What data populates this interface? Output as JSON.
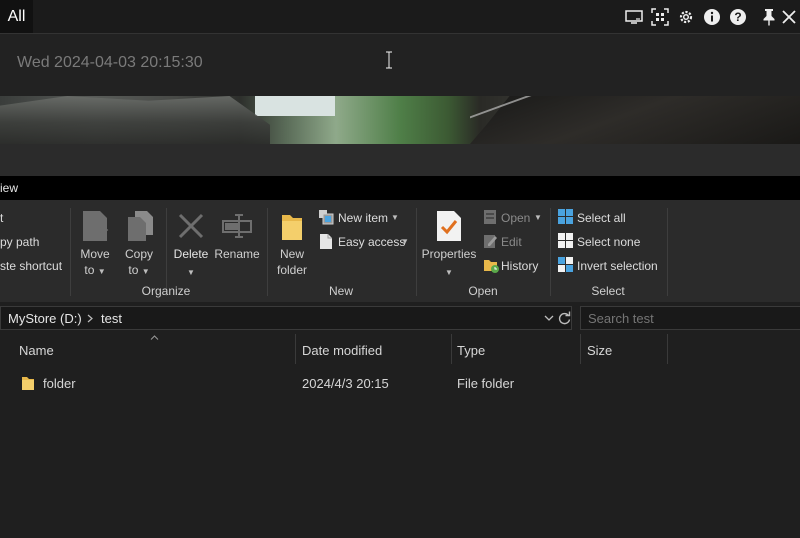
{
  "overlay": {
    "tab_label": "All",
    "clip_text": "Wed 2024-04-03 20:15:30",
    "icons": [
      "screen-icon",
      "qr-scan-icon",
      "settings-icon",
      "info-icon",
      "help-icon",
      "pin-icon",
      "close-icon"
    ]
  },
  "explorer": {
    "menu": {
      "view_label": "iew"
    },
    "ribbon": {
      "clipboard": {
        "cut": "t",
        "copy_path": "py path",
        "paste_shortcut": "ste shortcut"
      },
      "organize": {
        "move_to_1": "Move",
        "move_to_2": "to",
        "copy_to_1": "Copy",
        "copy_to_2": "to",
        "delete": "Delete",
        "rename": "Rename",
        "group": "Organize"
      },
      "new": {
        "new_folder_1": "New",
        "new_folder_2": "folder",
        "new_item": "New item",
        "easy_access": "Easy access",
        "group": "New"
      },
      "open": {
        "properties": "Properties",
        "open": "Open",
        "edit": "Edit",
        "history": "History",
        "group": "Open"
      },
      "select": {
        "select_all": "Select all",
        "select_none": "Select none",
        "invert_selection": "Invert selection",
        "group": "Select"
      }
    },
    "address": {
      "drive": "MyStore (D:)",
      "folder": "test",
      "search_placeholder": "Search test"
    },
    "columns": {
      "name": "Name",
      "date": "Date modified",
      "type": "Type",
      "size": "Size"
    },
    "rows": [
      {
        "name": "folder",
        "date": "2024/4/3 20:15",
        "type": "File folder",
        "size": ""
      }
    ]
  },
  "colors": {
    "folder_yellow": "#e8b84a",
    "accent_blue": "#4aa3df",
    "check_orange": "#e0701f"
  }
}
